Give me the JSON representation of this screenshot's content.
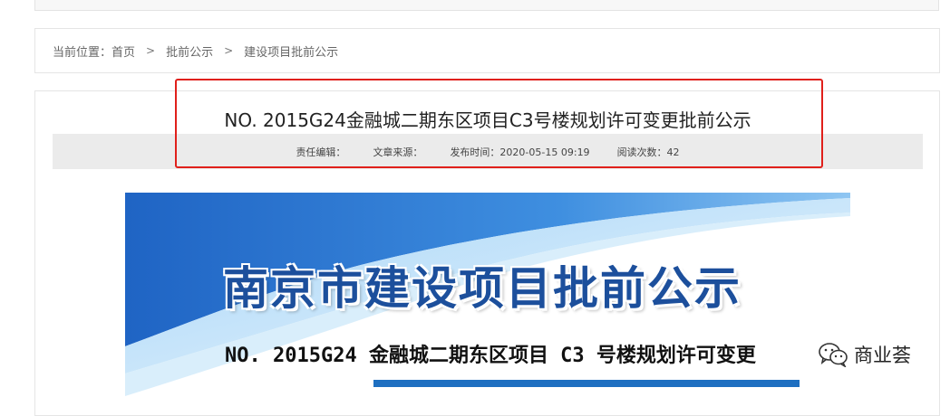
{
  "breadcrumb": {
    "prefix": "当前位置：",
    "home": "首页",
    "separator": ">",
    "level1": "批前公示",
    "level2": "建设项目批前公示"
  },
  "article": {
    "title": "NO. 2015G24金融城二期东区项目C3号楼规划许可变更批前公示",
    "meta": {
      "editor": "责任编辑：",
      "source": "文章来源：",
      "published": "发布时间：2020-05-15 09:19",
      "views": "阅读次数：42"
    }
  },
  "banner": {
    "title": "南京市建设项目批前公示",
    "subtitle": "NO. 2015G24 金融城二期东区项目 C3 号楼规划许可变更"
  },
  "watermark": {
    "text": "商业荟",
    "icon": "wechat-icon"
  },
  "colors": {
    "highlight": "#e0201b",
    "banner_blue": "#1c4f9c",
    "banner_accent": "#1e6fc1"
  }
}
